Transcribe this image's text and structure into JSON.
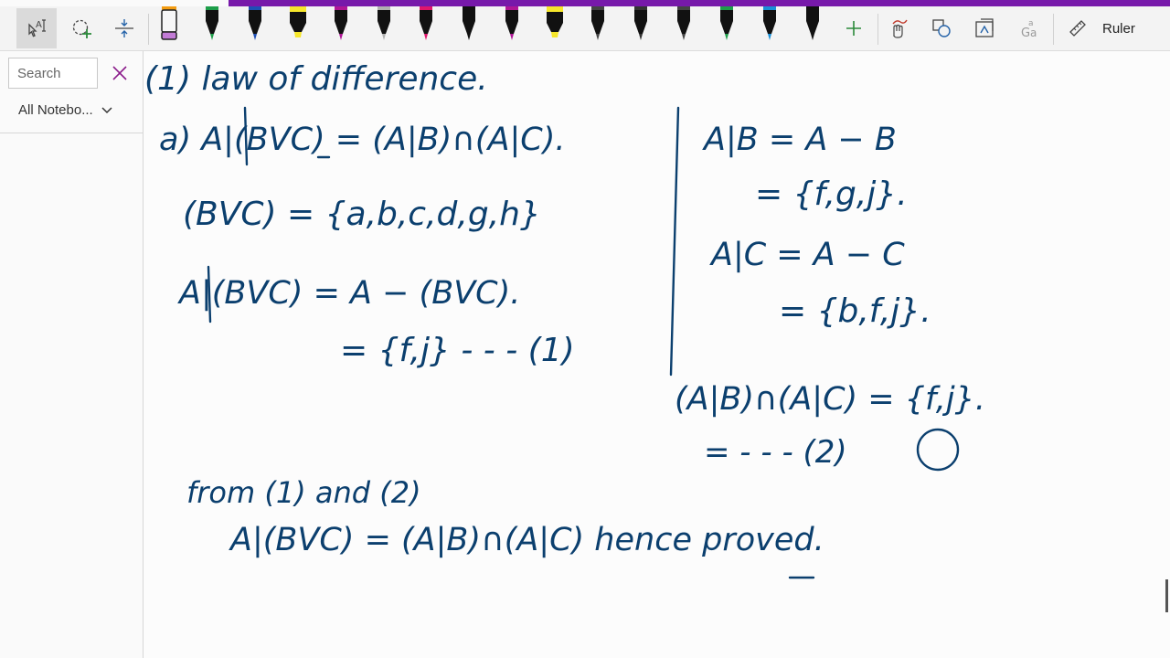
{
  "toolbar": {
    "tools": [
      "lasso-select-icon",
      "add-space-icon",
      "insert-space-icon"
    ],
    "pens": [
      {
        "color": "#e8e8e8",
        "tip": "#c37bd6",
        "kind": "eraser"
      },
      {
        "color": "#111111",
        "tip": "#1e9e4a",
        "kind": "pen"
      },
      {
        "color": "#111111",
        "tip": "#1f4fb5",
        "kind": "pen"
      },
      {
        "color": "#111111",
        "tip": "#f6e62b",
        "kind": "highlighter"
      },
      {
        "color": "#111111",
        "tip": "#b01696",
        "kind": "pen"
      },
      {
        "color": "#111111",
        "tip": "#b0b0b0",
        "kind": "pencil"
      },
      {
        "color": "#111111",
        "tip": "#e0166c",
        "kind": "pen"
      },
      {
        "color": "#111111",
        "tip": "#111111",
        "kind": "pen"
      },
      {
        "color": "#111111",
        "tip": "#b01696",
        "kind": "pen"
      },
      {
        "color": "#111111",
        "tip": "#f6e62b",
        "kind": "highlighter"
      },
      {
        "color": "#111111",
        "tip": "#444444",
        "kind": "pen"
      },
      {
        "color": "#111111",
        "tip": "#333333",
        "kind": "pen"
      },
      {
        "color": "#111111",
        "tip": "#444444",
        "kind": "pen"
      },
      {
        "color": "#111111",
        "tip": "#1e9e4a",
        "kind": "pen"
      },
      {
        "color": "#111111",
        "tip": "#1a8fd6",
        "kind": "pen"
      },
      {
        "color": "#111111",
        "tip": "#111111",
        "kind": "pen"
      }
    ],
    "ruler_label": "Ruler"
  },
  "sidebar": {
    "search_placeholder": "Search",
    "notebook_filter": "All Notebo..."
  },
  "colors": {
    "accent": "#7719aa",
    "ink": "#0b3f6e"
  },
  "notes": {
    "title": "(1) law of difference.",
    "line_a": "a) A|(BVC) = (A|B)∩(A|C).",
    "bvc": "(BVC) = {a,b,c,d,g,h}",
    "a_minus_bvc": "A|(BVC) = A − (BVC).",
    "result1": "= {f,j} - - - (1)",
    "ab": "A|B = A − B",
    "ab_set": "= {f,g,j}.",
    "ac": "A|C = A − C",
    "ac_set": "= {b,f,j}.",
    "intersection": "(A|B)∩(A|C) = {f,j}.",
    "result2": "= - - - (2)",
    "from": "from (1) and (2)",
    "conclusion": "A|(BVC) = (A|B)∩(A|C) hence proved."
  }
}
